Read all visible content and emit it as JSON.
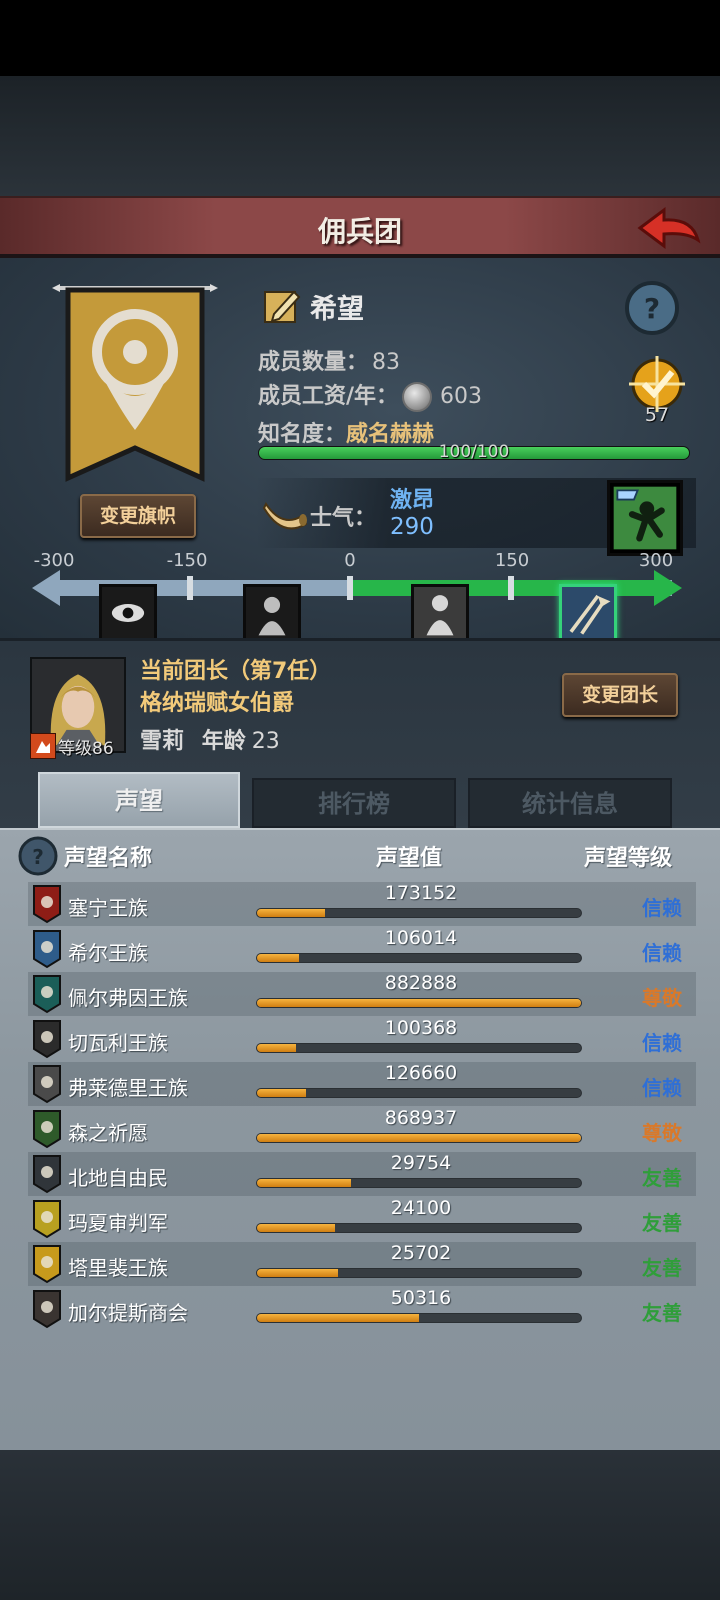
{
  "title": "佣兵团",
  "guild": {
    "name": "希望",
    "member_count_label": "成员数量：",
    "member_count": "83",
    "salary_label": "成员工资/年：",
    "salary": "603",
    "fame_label": "知名度：",
    "fame_title": "威名赫赫",
    "fame_progress_text": "100/100",
    "fame_progress": 1.0,
    "rank": "57",
    "change_flag_label": "变更旗帜"
  },
  "morale": {
    "label": "士气：",
    "state": "激昂",
    "value": "290",
    "scale_labels": [
      "-300",
      "-150",
      "0",
      "150",
      "300"
    ],
    "level_value": 290
  },
  "leader": {
    "title": "当前团长（第7任）",
    "noble_title": "格纳瑞赋女伯爵",
    "name": "雪莉",
    "age_label": "年龄",
    "age": "23",
    "level_text": "等级86",
    "change_leader_label": "变更团长"
  },
  "tabs": [
    {
      "label": "声望",
      "active": true
    },
    {
      "label": "排行榜",
      "active": false
    },
    {
      "label": "统计信息",
      "active": false
    }
  ],
  "reputation": {
    "headers": {
      "name": "声望名称",
      "value": "声望值",
      "level": "声望等级"
    },
    "colors": {
      "trust": "#2f6fd6",
      "respect": "#d9792a",
      "friendly": "#2f9e3a"
    },
    "rows": [
      {
        "name": "塞宁王族",
        "value": "173152",
        "fill": 0.21,
        "level": "信赖",
        "level_color": "#2f6fd6",
        "crest_color": "#8e1d16"
      },
      {
        "name": "希尔王族",
        "value": "106014",
        "fill": 0.13,
        "level": "信赖",
        "level_color": "#2f6fd6",
        "crest_color": "#2e5c8a"
      },
      {
        "name": "佩尔弗因王族",
        "value": "882888",
        "fill": 1.0,
        "level": "尊敬",
        "level_color": "#d9792a",
        "crest_color": "#1b5e58"
      },
      {
        "name": "切瓦利王族",
        "value": "100368",
        "fill": 0.12,
        "level": "信赖",
        "level_color": "#2f6fd6",
        "crest_color": "#2b2b2b"
      },
      {
        "name": "弗莱德里王族",
        "value": "126660",
        "fill": 0.15,
        "level": "信赖",
        "level_color": "#2f6fd6",
        "crest_color": "#4a4a4a"
      },
      {
        "name": "森之祈愿",
        "value": "868937",
        "fill": 1.0,
        "level": "尊敬",
        "level_color": "#d9792a",
        "crest_color": "#2e5a2a"
      },
      {
        "name": "北地自由民",
        "value": "29754",
        "fill": 0.29,
        "level": "友善",
        "level_color": "#2f9e3a",
        "crest_color": "#30353a"
      },
      {
        "name": "玛夏审判军",
        "value": "24100",
        "fill": 0.24,
        "level": "友善",
        "level_color": "#2f9e3a",
        "crest_color": "#b8a020"
      },
      {
        "name": "塔里裴王族",
        "value": "25702",
        "fill": 0.25,
        "level": "友善",
        "level_color": "#2f9e3a",
        "crest_color": "#c79a1c"
      },
      {
        "name": "加尔提斯商会",
        "value": "50316",
        "fill": 0.5,
        "level": "友善",
        "level_color": "#2f9e3a",
        "crest_color": "#3a3431"
      }
    ]
  }
}
